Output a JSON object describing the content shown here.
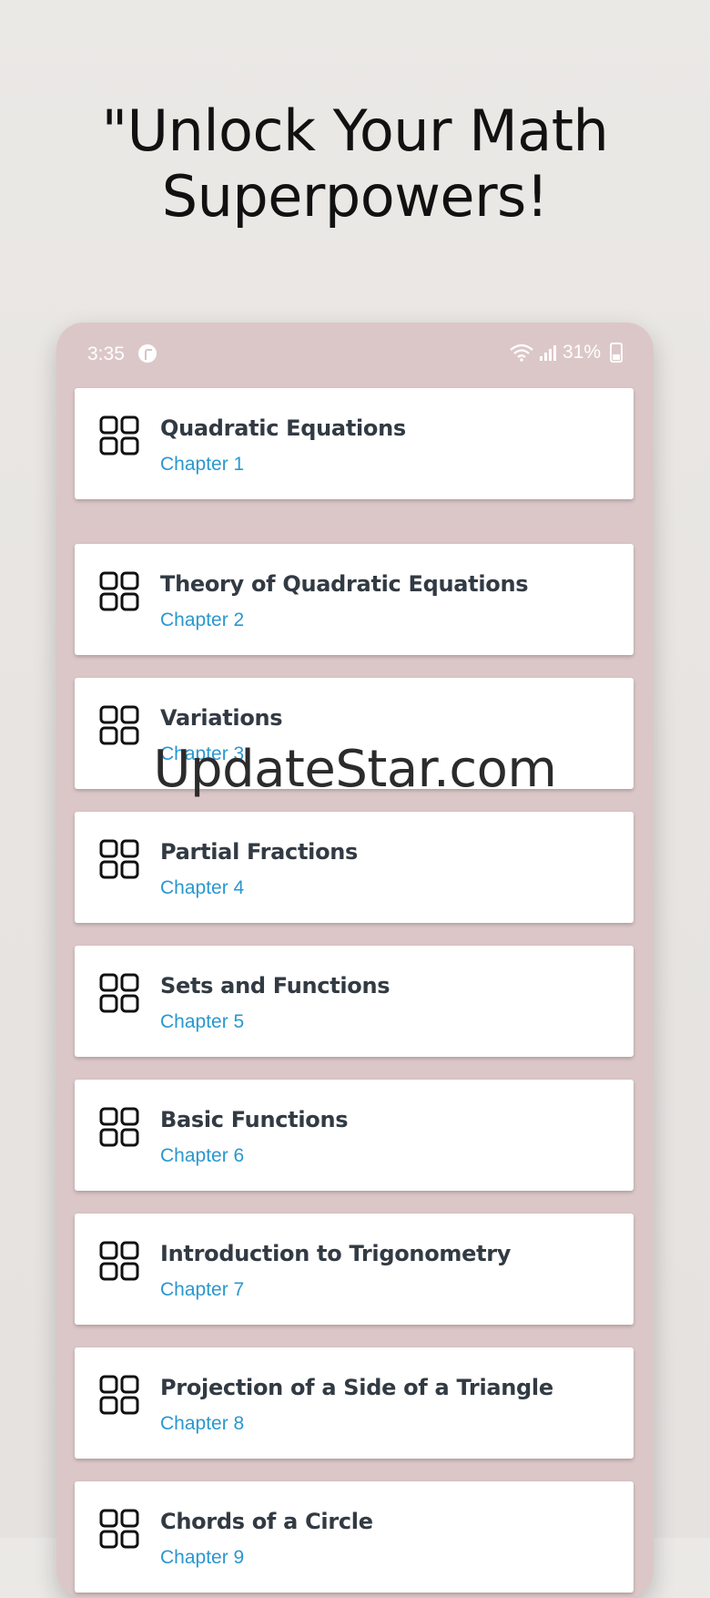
{
  "headline": {
    "line1": "\"Unlock Your Math",
    "line2": "Superpowers!"
  },
  "status_bar": {
    "time": "3:35",
    "battery": "31%",
    "icons": [
      "app-notification-icon",
      "wifi-icon",
      "signal-icon",
      "battery-charging-icon"
    ]
  },
  "chapters": [
    {
      "title": "Quadratic Equations",
      "subtitle": "Chapter 1",
      "icon": "grid-icon"
    },
    {
      "title": "Theory of Quadratic Equations",
      "subtitle": "Chapter 2",
      "icon": "grid-icon"
    },
    {
      "title": "Variations",
      "subtitle": "Chapter 3",
      "icon": "grid-icon"
    },
    {
      "title": "Partial Fractions",
      "subtitle": "Chapter 4",
      "icon": "grid-icon"
    },
    {
      "title": "Sets and Functions",
      "subtitle": "Chapter 5",
      "icon": "grid-icon"
    },
    {
      "title": "Basic Functions",
      "subtitle": "Chapter 6",
      "icon": "grid-icon"
    },
    {
      "title": "Introduction to Trigonometry",
      "subtitle": "Chapter 7",
      "icon": "grid-icon"
    },
    {
      "title": "Projection of a Side of a Triangle",
      "subtitle": "Chapter 8",
      "icon": "grid-icon"
    },
    {
      "title": "Chords of a Circle",
      "subtitle": "Chapter 9",
      "icon": "grid-icon"
    }
  ],
  "watermark": "UpdateStar.com",
  "colors": {
    "background": "#e8e5e2",
    "phone_frame": "#dcc7c8",
    "card": "#ffffff",
    "title_text": "#323a43",
    "subtitle_text": "#2a97d0"
  }
}
